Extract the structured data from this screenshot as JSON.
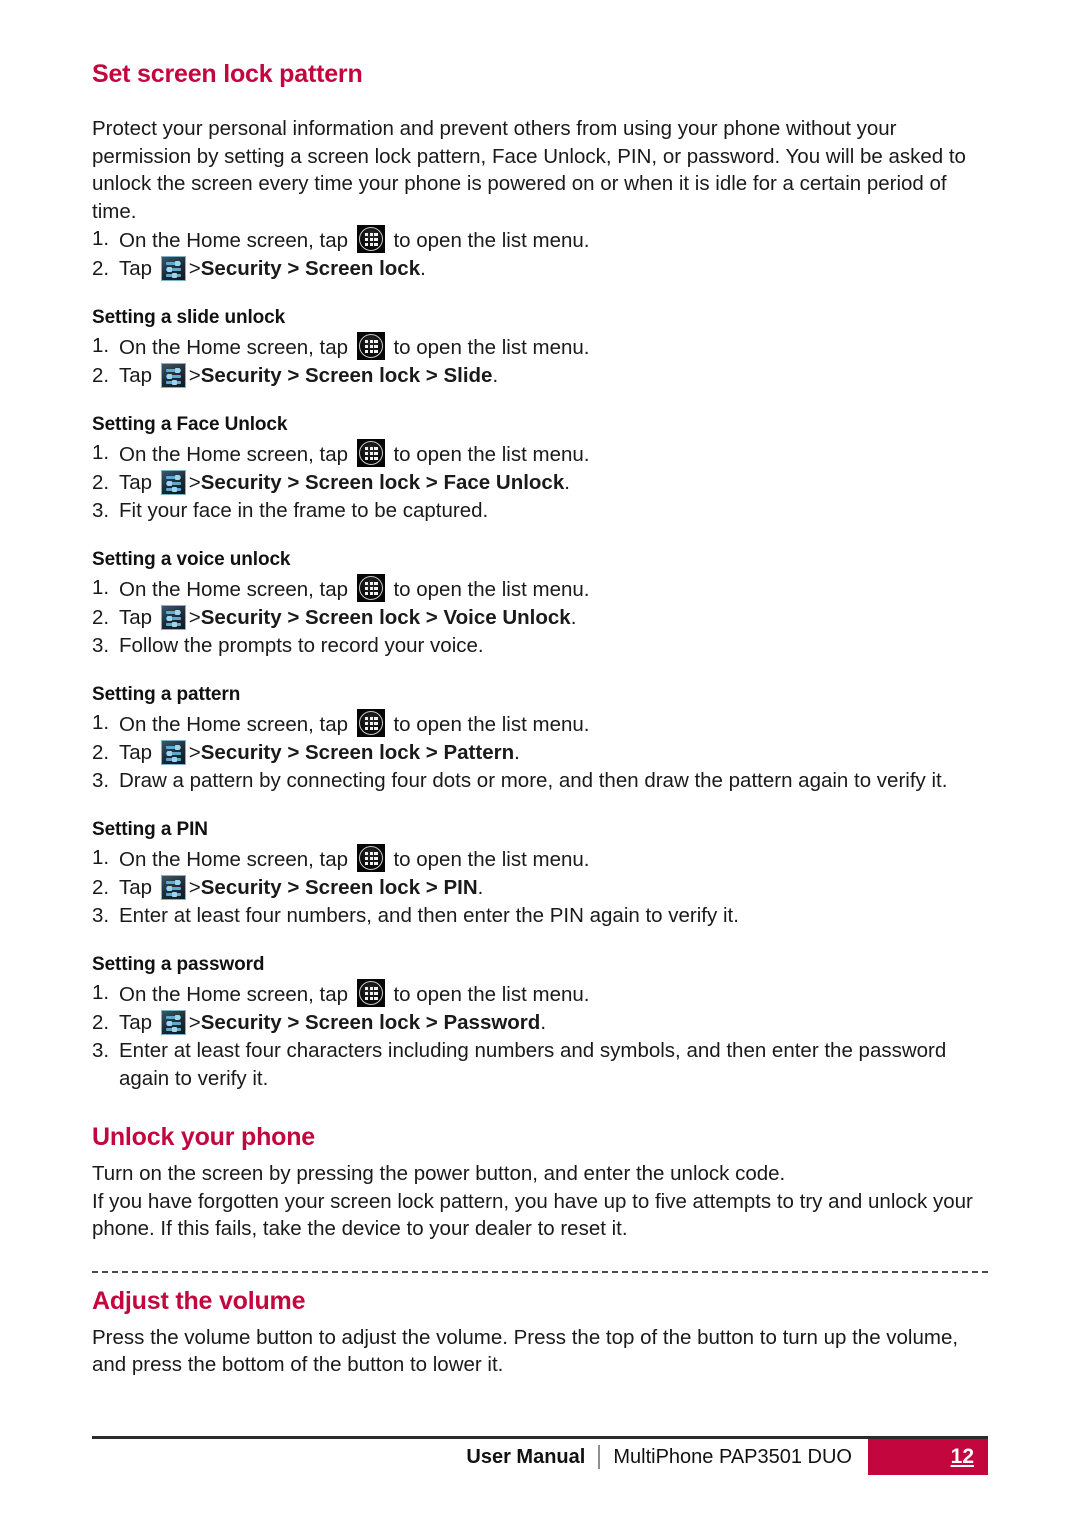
{
  "document": {
    "heading_color": "#c4063f",
    "sections": [
      {
        "id": "set-screen-lock-pattern",
        "title": "Set screen lock pattern",
        "intro": "Protect your personal information and prevent others from using your phone without your permission by setting a screen lock pattern, Face Unlock, PIN, or password. You will be asked to unlock the screen every time your phone is powered on or when it is idle for a certain period of time.",
        "steps": [
          {
            "num": "1.",
            "pre": "On the Home screen, tap",
            "icon": "app-drawer-icon",
            "post": "to open the list menu."
          },
          {
            "num": "2.",
            "pre": "Tap",
            "icon": "settings-icon",
            "path_prefix": ">",
            "path_bold": "Security > Screen lock",
            "post": "."
          }
        ]
      }
    ],
    "subsections": [
      {
        "id": "setting-a-slide-unlock",
        "title": "Setting a slide unlock",
        "steps": [
          {
            "num": "1.",
            "pre": "On the Home screen, tap",
            "icon": "app-drawer-icon",
            "post": "to open the list menu."
          },
          {
            "num": "2.",
            "pre": "Tap",
            "icon": "settings-icon",
            "path_prefix": ">",
            "path_bold": "Security > Screen lock > Slide",
            "post": "."
          }
        ]
      },
      {
        "id": "setting-a-face-unlock",
        "title": "Setting a Face Unlock",
        "steps": [
          {
            "num": "1.",
            "pre": "On the Home screen, tap",
            "icon": "app-drawer-icon",
            "post": "to open the list menu."
          },
          {
            "num": "2.",
            "pre": "Tap",
            "icon": "settings-icon",
            "path_prefix": ">",
            "path_bold": "Security > Screen lock > Face Unlock",
            "post": "."
          },
          {
            "num": "3.",
            "plain": "Fit your face in the frame to be captured."
          }
        ]
      },
      {
        "id": "setting-a-voice-unlock",
        "title": "Setting a voice unlock",
        "steps": [
          {
            "num": "1.",
            "pre": "On the Home screen, tap",
            "icon": "app-drawer-icon",
            "post": "to open the list menu."
          },
          {
            "num": "2.",
            "pre": "Tap",
            "icon": "settings-icon",
            "path_prefix": ">",
            "path_bold": "Security > Screen lock > Voice Unlock",
            "post": "."
          },
          {
            "num": "3.",
            "plain": "Follow the prompts to record your voice."
          }
        ]
      },
      {
        "id": "setting-a-pattern",
        "title": "Setting a pattern",
        "steps": [
          {
            "num": "1.",
            "pre": "On the Home screen, tap",
            "icon": "app-drawer-icon",
            "post": "to open the list menu."
          },
          {
            "num": "2.",
            "pre": "Tap",
            "icon": "settings-icon",
            "path_prefix": ">",
            "path_bold": "Security > Screen lock > Pattern",
            "post": "."
          },
          {
            "num": "3.",
            "plain": "Draw a pattern by connecting four dots or more, and then draw the pattern again to verify it."
          }
        ]
      },
      {
        "id": "setting-a-pin",
        "title": "Setting a PIN",
        "steps": [
          {
            "num": "1.",
            "pre": "On the Home screen, tap",
            "icon": "app-drawer-icon",
            "post": "to open the list menu."
          },
          {
            "num": "2.",
            "pre": "Tap",
            "icon": "settings-icon",
            "path_prefix": ">",
            "path_bold": "Security > Screen lock > PIN",
            "post": "."
          },
          {
            "num": "3.",
            "plain": "Enter at least four numbers, and then enter the PIN again to verify it."
          }
        ]
      },
      {
        "id": "setting-a-password",
        "title": "Setting a password",
        "steps": [
          {
            "num": "1.",
            "pre": "On the Home screen, tap",
            "icon": "app-drawer-icon",
            "post": "to open the list menu."
          },
          {
            "num": "2.",
            "pre": "Tap",
            "icon": "settings-icon",
            "path_prefix": ">",
            "path_bold": "Security > Screen lock > Password",
            "post": "."
          },
          {
            "num": "3.",
            "plain": "Enter at least four characters including numbers and symbols, and then enter the password again to verify it."
          }
        ]
      }
    ],
    "unlock_phone": {
      "title": "Unlock your phone",
      "paragraph1": "Turn on the screen by pressing the power button, and enter the unlock code.",
      "paragraph2": "If you have forgotten your screen lock pattern, you have up to five attempts to try and unlock your phone. If this fails, take the device to your dealer to reset it."
    },
    "adjust_volume": {
      "title": "Adjust the volume",
      "paragraph": "Press the volume button to adjust the volume. Press the top of the button to turn up the volume, and press the bottom of the button to lower it."
    },
    "footer": {
      "manual_label": "User Manual",
      "model": "MultiPhone PAP3501 DUO",
      "page_number": "12",
      "accent_color": "#c4063f"
    }
  }
}
